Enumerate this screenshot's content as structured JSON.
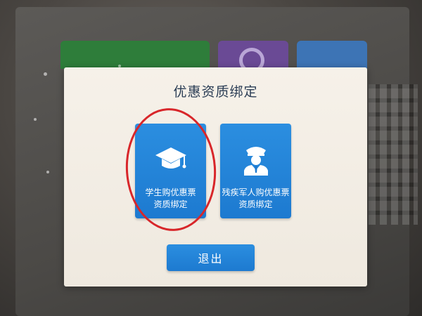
{
  "dialog": {
    "title": "优惠资质绑定",
    "options": [
      {
        "line1": "学生购优惠票",
        "line2": "资质绑定",
        "icon": "graduation-cap-icon",
        "highlighted": true
      },
      {
        "line1": "残疾军人购优惠票",
        "line2": "资质绑定",
        "icon": "military-officer-icon",
        "highlighted": false
      }
    ],
    "exit_label": "退出"
  },
  "colors": {
    "accent_blue": "#1d7ad0",
    "highlight_red": "#d8262a",
    "title_text": "#2b3d55"
  }
}
